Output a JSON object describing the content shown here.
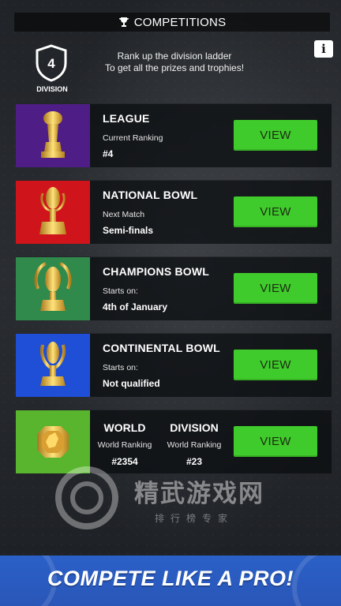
{
  "header": {
    "title": "COMPETITIONS",
    "icon": "trophy-icon"
  },
  "division": {
    "number": "4",
    "label": "DIVISION"
  },
  "intro": {
    "line1": "Rank up the division ladder",
    "line2": "To get all the prizes and trophies!"
  },
  "info_button": "i",
  "competitions": [
    {
      "title": "LEAGUE",
      "sub": "Current Ranking",
      "value": "#4",
      "button": "VIEW",
      "color": "#4e1e86",
      "icon": "league-trophy-icon"
    },
    {
      "title": "NATIONAL BOWL",
      "sub": "Next Match",
      "value": "Semi-finals",
      "button": "VIEW",
      "color": "#d0141b",
      "icon": "national-bowl-trophy-icon"
    },
    {
      "title": "CHAMPIONS BOWL",
      "sub": "Starts on:",
      "value": "4th of January",
      "button": "VIEW",
      "color": "#2f8a4c",
      "icon": "champions-bowl-trophy-icon"
    },
    {
      "title": "CONTINENTAL BOWL",
      "sub": "Starts on:",
      "value": "Not qualified",
      "button": "VIEW",
      "color": "#1f4fd6",
      "icon": "continental-bowl-trophy-icon"
    }
  ],
  "world": {
    "color": "#58b52d",
    "icon": "world-medal-icon",
    "col1": {
      "title": "WORLD",
      "sub": "World Ranking",
      "value": "#2354"
    },
    "col2": {
      "title": "DIVISION",
      "sub": "World Ranking",
      "value": "#23"
    },
    "button": "VIEW"
  },
  "watermark": {
    "text": "精武游戏网",
    "sub": "排行榜专家"
  },
  "banner": {
    "slogan": "COMPETE LIKE A PRO!"
  }
}
